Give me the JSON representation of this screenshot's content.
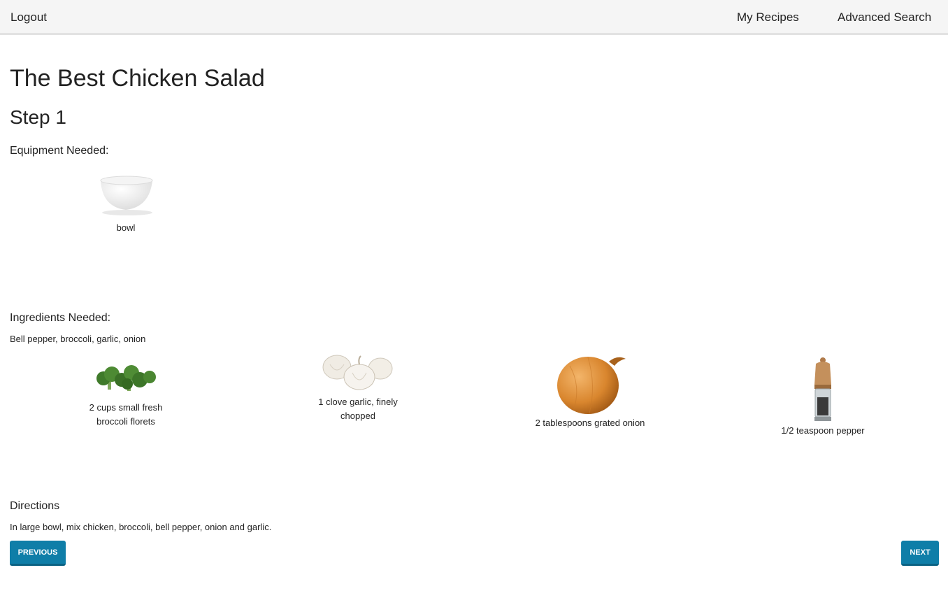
{
  "nav": {
    "logout": "Logout",
    "my_recipes": "My Recipes",
    "advanced_search": "Advanced Search"
  },
  "recipe": {
    "title": "The Best Chicken Salad",
    "step": "Step 1"
  },
  "equipment": {
    "heading": "Equipment Needed:",
    "items": [
      {
        "label": "bowl",
        "icon": "bowl-image"
      }
    ]
  },
  "ingredients": {
    "heading": "Ingredients Needed:",
    "summary": "Bell pepper, broccoli, garlic, onion",
    "items": [
      {
        "label": "2 cups small fresh broccoli florets",
        "icon": "broccoli-image"
      },
      {
        "label": "1 clove garlic, finely chopped",
        "icon": "garlic-image"
      },
      {
        "label": "2 tablespoons grated onion",
        "icon": "onion-image"
      },
      {
        "label": "1/2 teaspoon pepper",
        "icon": "pepper-mill-image"
      }
    ]
  },
  "directions": {
    "heading": "Directions",
    "text": "In large bowl, mix chicken, broccoli, bell pepper, onion and garlic."
  },
  "buttons": {
    "previous": "PREVIOUS",
    "next": "NEXT"
  },
  "colors": {
    "button": "#0f7ea8",
    "topbar": "#f5f5f5"
  }
}
